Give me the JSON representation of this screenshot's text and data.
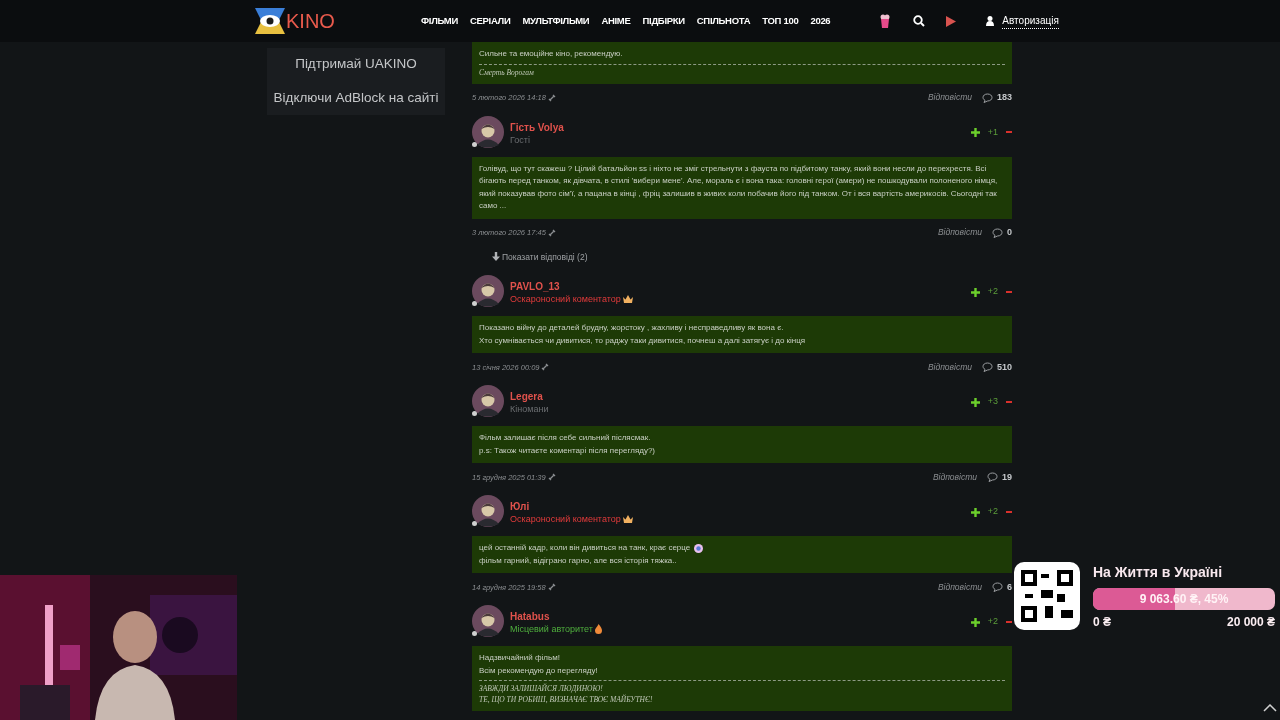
{
  "header": {
    "logo": "KINO",
    "nav": [
      "ФІЛЬМИ",
      "СЕРІАЛИ",
      "МУЛЬТФІЛЬМИ",
      "АНІМЕ",
      "ПІДБІРКИ",
      "СПІЛЬНОТА",
      "ТОП 100",
      "2026"
    ],
    "login": "Авторизація"
  },
  "sidebar": {
    "links": [
      "Підтримай UAKINO",
      "Відключи AdBlock на сайті"
    ]
  },
  "comments": [
    {
      "lines": [
        {
          "text": "Сильне та емоційне кіно, рекомендую.",
          "sticker": false
        }
      ],
      "signature": [
        "Смерть Ворогам"
      ],
      "date": "5 лютого 2026 14:18",
      "reply": "Відповісти",
      "count": "183"
    },
    {
      "author": {
        "name": "Гість Volya",
        "rank": {
          "text": "Гості",
          "kind": "guest"
        }
      },
      "score": "+1",
      "lines": [
        {
          "text": "Голівуд, що тут скажеш ? Цілий батальйон ss і ніхто не зміг стрельнути з фауста по підбитому танку, який вони несли до перехрестя. Всі бігають перед танком, як дівчата, в стилі 'вибери мене'. Але, мораль є і вона така: головні герої (амери) не пошкодували полоненого німця, який показував фото сім'ї, а пацана в кінці , фріц залишив в живих коли побачив його під танком. От і вся вартість америкосів. Сьогодні так само ...",
          "sticker": false
        }
      ],
      "date": "3 лютого 2026 17:45",
      "reply": "Відповісти",
      "count": "0",
      "replies_toggle": "Показати відповіді (2)"
    },
    {
      "author": {
        "name": "PAVLO_13",
        "rank": {
          "text": "Оскароносний коментатор",
          "kind": "oscar"
        }
      },
      "score": "+2",
      "lines": [
        {
          "text": "Показано війну до деталей брудну, жорстоку , жахливу і несправедливу як вона є.",
          "sticker": false
        },
        {
          "text": "Хто сумнівається чи дивитися, то раджу таки дивитися, почнеш а далі затягує і до кінця",
          "sticker": false
        }
      ],
      "date": "13 січня 2026 00:09",
      "reply": "Відповісти",
      "count": "510"
    },
    {
      "author": {
        "name": "Legera",
        "rank": {
          "text": "Кіномани",
          "kind": "guest"
        }
      },
      "score": "+3",
      "lines": [
        {
          "text": "Фільм залишає після себе сильний післясмак.",
          "sticker": false
        },
        {
          "text": "p.s: Також читаєте коментарі після перегляду?)",
          "sticker": false
        }
      ],
      "date": "15 грудня 2025 01:39",
      "reply": "Відповісти",
      "count": "19"
    },
    {
      "author": {
        "name": "Юлі",
        "rank": {
          "text": "Оскароносний коментатор",
          "kind": "oscar"
        }
      },
      "score": "+2",
      "lines": [
        {
          "text": "цей останній кадр, коли він дивиться на танк, крає серце",
          "sticker": true
        },
        {
          "text": "фільм гарний, відіграно гарно, але вся історія тяжка..",
          "sticker": false
        }
      ],
      "date": "14 грудня 2025 19:58",
      "reply": "Відповісти",
      "count": "6"
    },
    {
      "author": {
        "name": "Hatabus",
        "rank": {
          "text": "Місцевий авторитет",
          "kind": "authority"
        }
      },
      "score": "+2",
      "lines": [
        {
          "text": "Надзвичайний фільм!",
          "sticker": false
        },
        {
          "text": "Всім рекомендую до перегляду!",
          "sticker": false
        }
      ],
      "signature": [
        "ЗАВЖДИ ЗАЛИШАЙСЯ ЛЮДИНОЮ!",
        "ТЕ, ЩО ТИ РОБИШ, ВИЗНАЧАЄ ТВОЄ МАЙБУТНЄ!"
      ]
    }
  ],
  "donation": {
    "title": "На Життя в Україні",
    "amount": "9 063.60 ₴, 45%",
    "level": 0.45,
    "min": "0 ₴",
    "max": "20 000 ₴"
  }
}
